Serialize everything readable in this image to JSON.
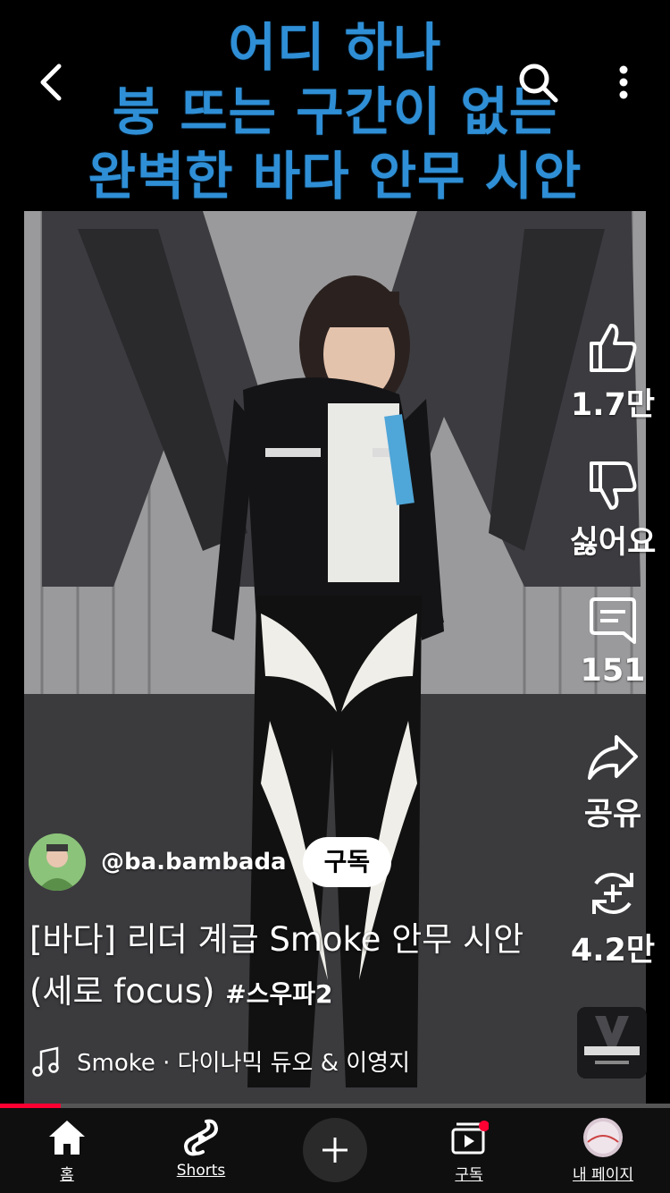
{
  "caption": {
    "line1": "어디 하나",
    "line2": "붕 뜨는 구간이 없는",
    "line3": "완벽한 바다 안무 시안",
    "color": "#2f8fd6"
  },
  "top_bar": {
    "back_icon": "chevron-left-icon",
    "search_icon": "search-icon",
    "more_icon": "more-vertical-icon"
  },
  "actions": {
    "like_count": "1.7만",
    "dislike_label": "싫어요",
    "comment_count": "151",
    "share_label": "공유",
    "remix_count": "4.2만"
  },
  "channel": {
    "handle": "@ba.bambada",
    "subscribe_label": "구독"
  },
  "video": {
    "title": "[바다] 리더 계급 Smoke 안무 시안 (세로 focus)",
    "hashtag": "#스우파2",
    "music": "Smoke · 다이나믹 듀오 & 이영지",
    "progress": 0.09
  },
  "nav": {
    "home_label": "홈",
    "shorts_label": "Shorts",
    "subscriptions_label": "구독",
    "profile_label": "내 페이지"
  },
  "colors": {
    "accent": "#ff0033",
    "background": "#000000"
  }
}
